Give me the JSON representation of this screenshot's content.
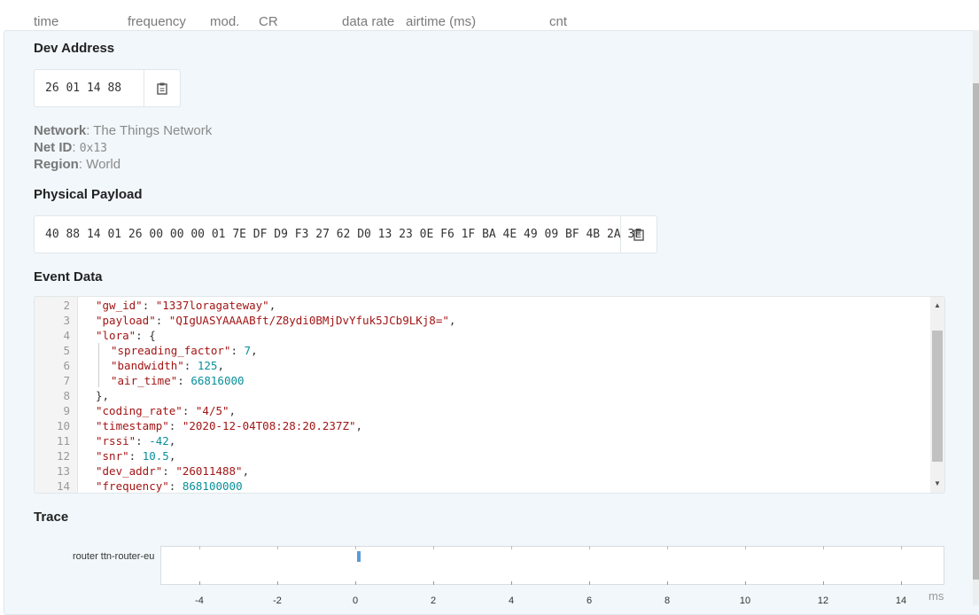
{
  "columns": [
    "time",
    "frequency",
    "mod.",
    "CR",
    "data rate",
    "airtime (ms)",
    "cnt"
  ],
  "dev_address": {
    "title": "Dev Address",
    "value": "26 01 14 88",
    "copy_icon": "clipboard-icon"
  },
  "network": {
    "network_label": "Network",
    "network_value": "The Things Network",
    "netid_label": "Net ID",
    "netid_value": "0x13",
    "region_label": "Region",
    "region_value": "World"
  },
  "physical_payload": {
    "title": "Physical Payload",
    "value": "40 88 14 01 26 00 00 00 01 7E DF D9 F3 27 62 D0 13 23 0E F6 1F BA 4E 49 09 BF 4B 2A 3F",
    "copy_icon": "clipboard-icon"
  },
  "event_data": {
    "title": "Event Data",
    "lines": [
      {
        "n": "2",
        "key": "\"gw_id\"",
        "val": "\"1337loragateway\"",
        "type": "s",
        "indent": 1,
        "end": ","
      },
      {
        "n": "3",
        "key": "\"payload\"",
        "val": "\"QIgUASYAAAABft/Z8ydi0BMjDvYfuk5JCb9LKj8=\"",
        "type": "s",
        "indent": 1,
        "end": ","
      },
      {
        "n": "4",
        "key": "\"lora\"",
        "val": "{",
        "type": "p",
        "indent": 1,
        "end": ""
      },
      {
        "n": "5",
        "key": "\"spreading_factor\"",
        "val": "7",
        "type": "n",
        "indent": 2,
        "end": ","
      },
      {
        "n": "6",
        "key": "\"bandwidth\"",
        "val": "125",
        "type": "n",
        "indent": 2,
        "end": ","
      },
      {
        "n": "7",
        "key": "\"air_time\"",
        "val": "66816000",
        "type": "n",
        "indent": 2,
        "end": ""
      },
      {
        "n": "8",
        "key": "",
        "val": "},",
        "type": "p",
        "indent": 1,
        "end": ""
      },
      {
        "n": "9",
        "key": "\"coding_rate\"",
        "val": "\"4/5\"",
        "type": "s",
        "indent": 1,
        "end": ","
      },
      {
        "n": "10",
        "key": "\"timestamp\"",
        "val": "\"2020-12-04T08:28:20.237Z\"",
        "type": "s",
        "indent": 1,
        "end": ","
      },
      {
        "n": "11",
        "key": "\"rssi\"",
        "val": "-42",
        "type": "n",
        "indent": 1,
        "end": ","
      },
      {
        "n": "12",
        "key": "\"snr\"",
        "val": "10.5",
        "type": "n",
        "indent": 1,
        "end": ","
      },
      {
        "n": "13",
        "key": "\"dev_addr\"",
        "val": "\"26011488\"",
        "type": "s",
        "indent": 1,
        "end": ","
      },
      {
        "n": "14",
        "key": "\"frequency\"",
        "val": "868100000",
        "type": "n",
        "indent": 1,
        "end": ""
      }
    ]
  },
  "trace": {
    "title": "Trace",
    "row_label": "router ttn-router-eu",
    "ticks": [
      "-4",
      "-2",
      "0",
      "2",
      "4",
      "6",
      "8",
      "10",
      "12",
      "14"
    ],
    "unit": "ms",
    "event_at": 0.05,
    "colors": {
      "event": "#5b9bd5"
    }
  }
}
